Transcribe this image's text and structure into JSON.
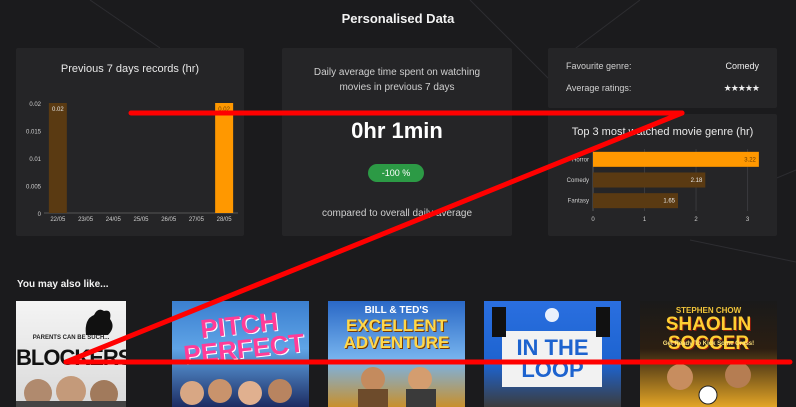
{
  "page": {
    "title": "Personalised Data"
  },
  "previous_days_card": {
    "title": "Previous 7 days records (hr)"
  },
  "daily_average_card": {
    "title": "Daily average time spent on watching movies in previous 7 days",
    "value": "0hr 1min",
    "change_badge": "-100 %",
    "compare_text": "compared to overall daily average"
  },
  "favourites_card": {
    "genre_label": "Favourite genre:",
    "genre_value": "Comedy",
    "ratings_label": "Average ratings:",
    "ratings_stars": "★★★★★"
  },
  "top_genre_card": {
    "title": "Top 3 most watched movie genre (hr)"
  },
  "recommendations": {
    "title": "You may also like...",
    "posters": [
      {
        "title_top": "PARENTS CAN BE SUCH...",
        "title": "BLOCKERS"
      },
      {
        "title": "PITCH PERFECT"
      },
      {
        "title_top": "BILL & TED'S",
        "title": "EXCELLENT ADVENTURE"
      },
      {
        "title": "IN THE LOOP"
      },
      {
        "title_top": "STEPHEN CHOW",
        "title": "SHAOLIN SOCCER",
        "tagline": "Get Ready To Kick Some Grass!"
      }
    ]
  },
  "colors": {
    "bar_orange": "#ff9800",
    "bar_brown": "#5a3a12",
    "badge_green": "#2c9a45",
    "star_orange": "#ff9d1b",
    "annotation_red": "#ff0000"
  },
  "chart_data": [
    {
      "type": "bar",
      "title": "Previous 7 days records (hr)",
      "categories": [
        "22/05",
        "23/05",
        "24/05",
        "25/05",
        "26/05",
        "27/05",
        "28/05"
      ],
      "values": [
        0.02,
        0,
        0,
        0,
        0,
        0,
        0.02
      ],
      "data_labels": [
        "0.02",
        "",
        "",
        "",
        "",
        "",
        "0.02"
      ],
      "ylim": [
        0,
        0.02
      ],
      "yticks": [
        "0",
        "0.005",
        "0.01",
        "0.015",
        "0.02"
      ],
      "grid": false
    },
    {
      "type": "bar",
      "orientation": "horizontal",
      "title": "Top 3 most watched movie genre (hr)",
      "categories": [
        "Horror",
        "Comedy",
        "Fantasy"
      ],
      "values": [
        3.22,
        2.18,
        1.65
      ],
      "xlim": [
        0,
        3.3
      ],
      "xticks": [
        "0",
        "1",
        "2",
        "3"
      ],
      "grid": true
    }
  ]
}
